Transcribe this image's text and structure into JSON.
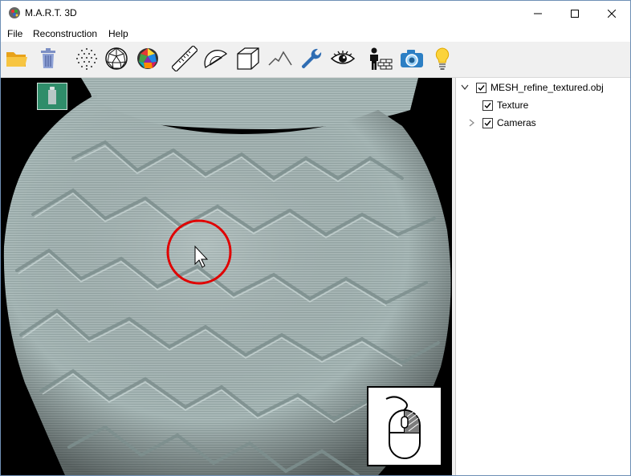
{
  "window": {
    "title": "M.A.R.T. 3D"
  },
  "menu": {
    "items": [
      "File",
      "Reconstruction",
      "Help"
    ]
  },
  "toolbar": {
    "buttons": [
      {
        "icon": "folder-open-icon"
      },
      {
        "icon": "trash-icon"
      },
      {
        "icon": "point-cloud-icon"
      },
      {
        "icon": "mesh-sphere-icon"
      },
      {
        "icon": "textured-sphere-icon"
      },
      {
        "icon": "ruler-icon"
      },
      {
        "icon": "protractor-icon"
      },
      {
        "icon": "bounding-box-icon"
      },
      {
        "icon": "terrain-icon"
      },
      {
        "icon": "wrench-icon"
      },
      {
        "icon": "eye-icon"
      },
      {
        "icon": "builder-icon"
      },
      {
        "icon": "camera-icon"
      },
      {
        "icon": "lightbulb-icon"
      }
    ]
  },
  "tree": {
    "root": {
      "label": "MESH_refine_textured.obj",
      "checked": true,
      "expanded": true
    },
    "children": [
      {
        "label": "Texture",
        "checked": true,
        "expandable": false
      },
      {
        "label": "Cameras",
        "checked": true,
        "expandable": true
      }
    ]
  },
  "viewport": {
    "thumbnail_icon": "scan-thumbnail-icon",
    "mouse_hint_icon": "mouse-right-button-icon",
    "cursor_highlight_color": "#e00000",
    "mesh_color": "#a9b9b8"
  }
}
